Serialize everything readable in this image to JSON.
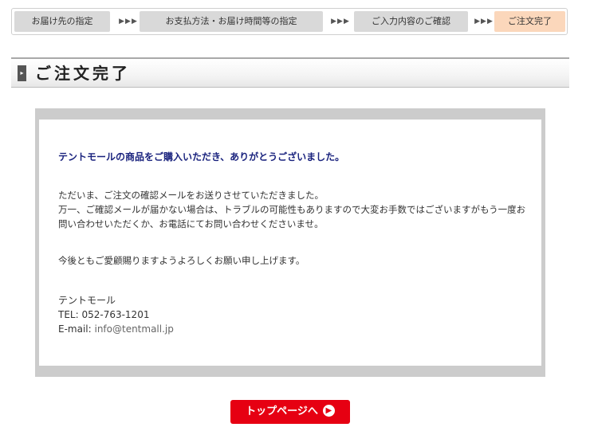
{
  "steps": {
    "items": [
      {
        "label": "お届け先の指定"
      },
      {
        "label": "お支払方法・お届け時間等の指定"
      },
      {
        "label": "ご入力内容のご確認"
      },
      {
        "label": "ご注文完了"
      }
    ],
    "separator": "▶▶▶"
  },
  "title": {
    "marker": "▸",
    "text": "ご注文完了"
  },
  "message": {
    "thanks": "テントモールの商品をご購入いただき、ありがとうございました。",
    "paragraph1": [
      "ただいま、ご注文の確認メールをお送りさせていただきました。",
      "万一、ご確認メールが届かない場合は、トラブルの可能性もありますので大変お手数ではございますがもう一度お",
      "問い合わせいただくか、お電話にてお問い合わせくださいませ。"
    ],
    "paragraph2": "今後ともご愛顧賜りますようよろしくお願い申し上げます。",
    "contact": {
      "name": "テントモール",
      "tel": "TEL: 052-763-1201",
      "email_label": "E-mail: ",
      "email": "info@tentmall.jp"
    }
  },
  "button": {
    "label": "トップページへ",
    "icon": "arrow-circle-right-icon"
  },
  "colors": {
    "current_step": "#fbd7bb",
    "step": "#d9d9d9",
    "thanks_text": "#1a237e",
    "button": "#e60012"
  }
}
